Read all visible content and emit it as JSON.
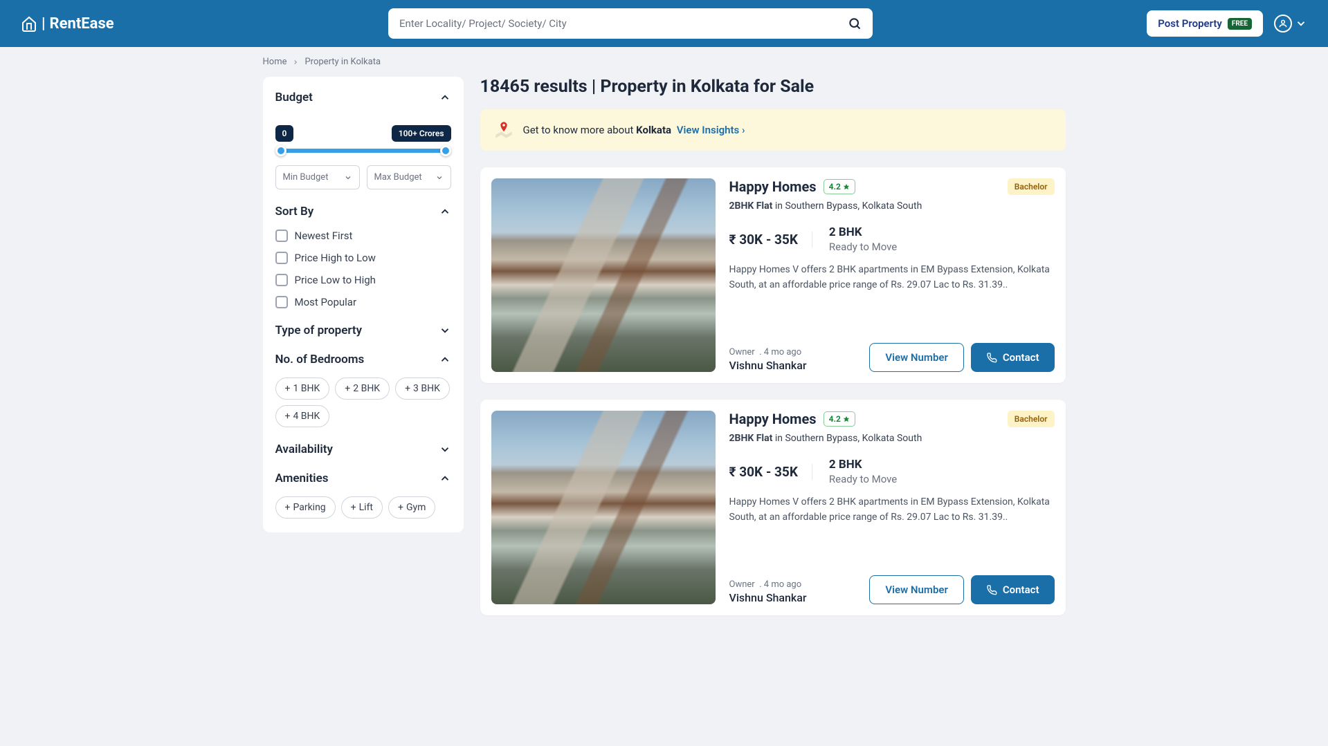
{
  "header": {
    "brand": "RentEase",
    "search_placeholder": "Enter Locality/ Project/ Society/ City",
    "post_property": "Post Property",
    "free_badge": "FREE"
  },
  "breadcrumb": {
    "home": "Home",
    "current": "Property in Kolkata"
  },
  "results_title": "18465 results | Property in Kolkata for Sale",
  "insight": {
    "prefix": "Get to know more about ",
    "city": "Kolkata",
    "link": "View Insights"
  },
  "filters": {
    "budget": {
      "title": "Budget",
      "min_label": "0",
      "max_label": "100+ Crores",
      "min_select": "Min Budget",
      "max_select": "Max Budget"
    },
    "sort": {
      "title": "Sort By",
      "options": [
        "Newest First",
        "Price High to Low",
        "Price Low to High",
        "Most Popular"
      ]
    },
    "type": {
      "title": "Type of property"
    },
    "bedrooms": {
      "title": "No. of Bedrooms",
      "chips": [
        "1 BHK",
        "2 BHK",
        "3 BHK",
        "4 BHK"
      ]
    },
    "availability": {
      "title": "Availability"
    },
    "amenities": {
      "title": "Amenities",
      "chips": [
        "Parking",
        "Lift",
        "Gym"
      ]
    }
  },
  "listings": [
    {
      "title": "Happy Homes",
      "rating": "4.2",
      "tag": "Bachelor",
      "type": "2BHK Flat",
      "location": "in Southern Bypass, Kolkata South",
      "price": "₹ 30K - 35K",
      "bhk": "2 BHK",
      "status": "Ready to Move",
      "desc": "Happy Homes V offers 2 BHK apartments in EM Bypass Extension, Kolkata South, at an affordable price range of Rs. 29.07 Lac to Rs. 31.39..",
      "owner_label": "Owner",
      "posted": "4 mo ago",
      "owner_name": "Vishnu Shankar",
      "view_number": "View Number",
      "contact": "Contact"
    },
    {
      "title": "Happy Homes",
      "rating": "4.2",
      "tag": "Bachelor",
      "type": "2BHK Flat",
      "location": "in Southern Bypass, Kolkata South",
      "price": "₹ 30K - 35K",
      "bhk": "2 BHK",
      "status": "Ready to Move",
      "desc": "Happy Homes V offers 2 BHK apartments in EM Bypass Extension, Kolkata South, at an affordable price range of Rs. 29.07 Lac to Rs. 31.39..",
      "owner_label": "Owner",
      "posted": "4 mo ago",
      "owner_name": "Vishnu Shankar",
      "view_number": "View Number",
      "contact": "Contact"
    }
  ]
}
